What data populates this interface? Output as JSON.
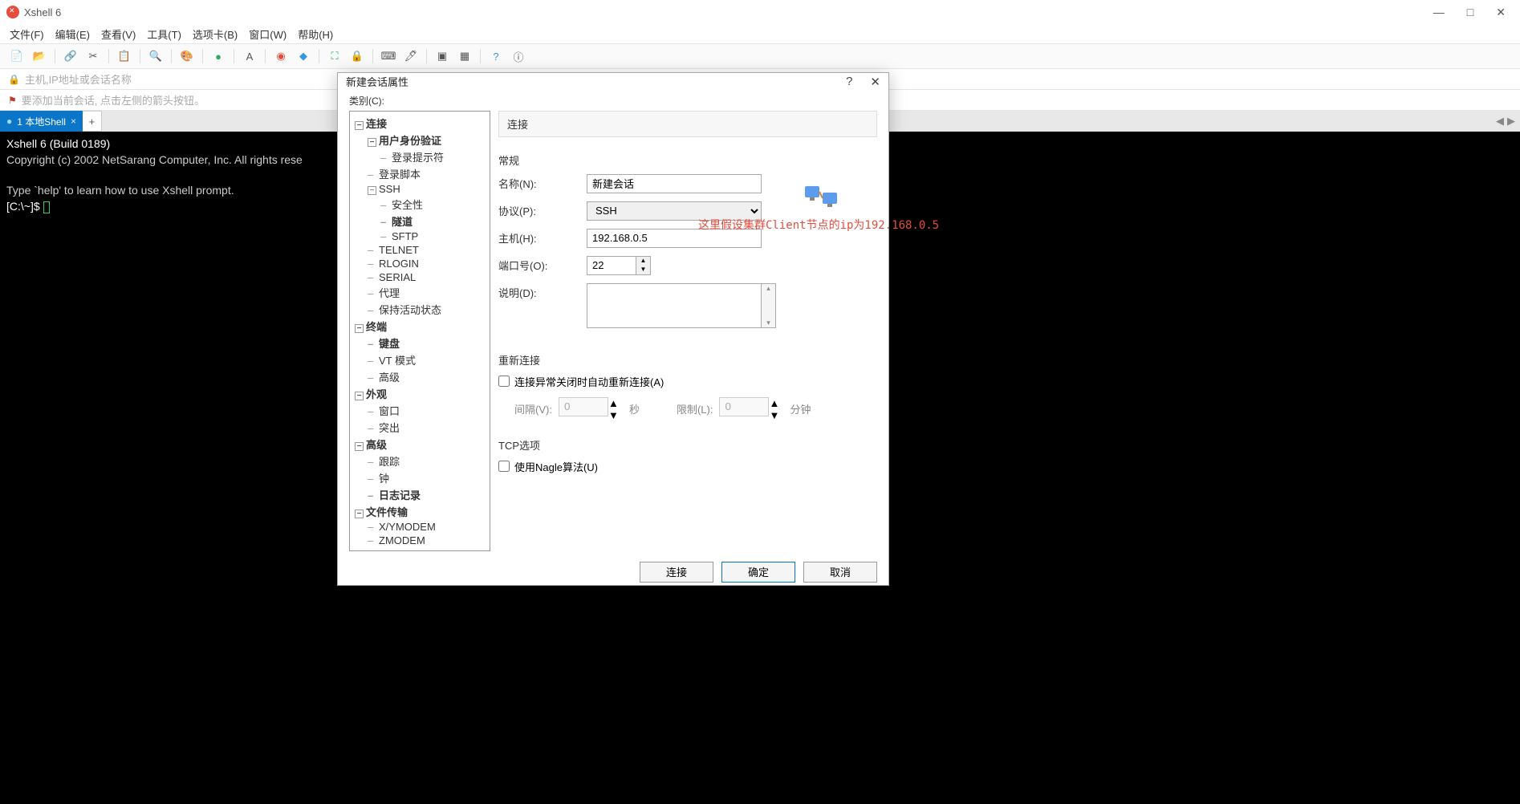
{
  "app": {
    "title": "Xshell 6"
  },
  "win_controls": {
    "min": "—",
    "max": "□",
    "close": "✕"
  },
  "menubar": [
    "文件(F)",
    "编辑(E)",
    "查看(V)",
    "工具(T)",
    "选项卡(B)",
    "窗口(W)",
    "帮助(H)"
  ],
  "addressbar": {
    "placeholder": "主机,IP地址或会话名称"
  },
  "hintbar": {
    "text": "要添加当前会话, 点击左侧的箭头按钮。"
  },
  "tab": {
    "label": "1 本地Shell",
    "add": "+"
  },
  "terminal": {
    "line1": "Xshell 6 (Build 0189)",
    "line2": "Copyright (c) 2002 NetSarang Computer, Inc. All rights rese",
    "line3": "",
    "line4": "Type `help' to learn how to use Xshell prompt.",
    "prompt": "[C:\\~]$ "
  },
  "dialog": {
    "title": "新建会话属性",
    "help": "?",
    "close": "✕",
    "category_label": "类别(C):",
    "tree": {
      "connection": "连接",
      "user_auth": "用户身份验证",
      "login_prompt": "登录提示符",
      "login_script": "登录脚本",
      "ssh": "SSH",
      "security": "安全性",
      "tunnel": "隧道",
      "sftp": "SFTP",
      "telnet": "TELNET",
      "rlogin": "RLOGIN",
      "serial": "SERIAL",
      "proxy": "代理",
      "keepalive": "保持活动状态",
      "terminal": "终端",
      "keyboard": "键盘",
      "vt": "VT 模式",
      "advanced_t": "高级",
      "appearance": "外观",
      "window": "窗口",
      "highlight": "突出",
      "advanced": "高级",
      "trace": "跟踪",
      "bell": "钟",
      "logging": "日志记录",
      "file_transfer": "文件传输",
      "xymodem": "X/YMODEM",
      "zmodem": "ZMODEM"
    },
    "pane_header": "连接",
    "general": {
      "label": "常规",
      "name_lbl": "名称(N):",
      "name_val": "新建会话",
      "proto_lbl": "协议(P):",
      "proto_val": "SSH",
      "host_lbl": "主机(H):",
      "host_val": "192.168.0.5",
      "port_lbl": "端口号(O):",
      "port_val": "22",
      "desc_lbl": "说明(D):"
    },
    "reconnect": {
      "label": "重新连接",
      "chk_lbl": "连接异常关闭时自动重新连接(A)",
      "interval_lbl": "间隔(V):",
      "interval_val": "0",
      "interval_unit": "秒",
      "limit_lbl": "限制(L):",
      "limit_val": "0",
      "limit_unit": "分钟"
    },
    "tcp": {
      "label": "TCP选项",
      "nagle_lbl": "使用Nagle算法(U)"
    },
    "footer": {
      "connect": "连接",
      "ok": "确定",
      "cancel": "取消"
    }
  },
  "annotation": "这里假设集群Client节点的ip为192.168.0.5"
}
